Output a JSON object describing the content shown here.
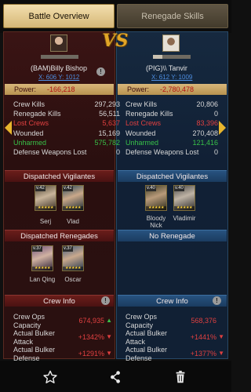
{
  "tabs": {
    "active": "Battle Overview",
    "inactive": "Renegade Skills"
  },
  "vs_label": "VS",
  "left": {
    "name": "(BAM)Billy Bishop",
    "coords": "X: 606 Y: 1012",
    "power_label": "Power:",
    "power": "-166,218",
    "stats": [
      {
        "label": "Crew Kills",
        "value": "297,293",
        "color": "default"
      },
      {
        "label": "Renegade Kills",
        "value": "56,511",
        "color": "default"
      },
      {
        "label": "Lost Crews",
        "value": "5,637",
        "color": "red"
      },
      {
        "label": "Wounded",
        "value": "15,169",
        "color": "default"
      },
      {
        "label": "Unharmed",
        "value": "575,782",
        "color": "green"
      },
      {
        "label": "Defense Weapons Lost",
        "value": "0",
        "color": "default"
      }
    ],
    "vigilantes_title": "Dispatched Vigilantes",
    "vigilantes": [
      {
        "level": "v.42",
        "name": "Serj"
      },
      {
        "level": "v.42",
        "name": "Vlad"
      }
    ],
    "renegades_title": "Dispatched Renegades",
    "renegades": [
      {
        "level": "v.37",
        "name": "Lan Qing"
      },
      {
        "level": "v.37",
        "name": "Oscar"
      }
    ],
    "crew_info_title": "Crew Info",
    "crew_info": [
      {
        "label": "Crew Ops Capacity",
        "value": "674,935",
        "indicator": "up"
      },
      {
        "label": "Actual Bulker Attack",
        "value": "+1342%",
        "indicator": "down"
      },
      {
        "label": "Actual Bulker Defense",
        "value": "+1291%",
        "indicator": "down"
      }
    ]
  },
  "right": {
    "name": "(PIG)\\\\ Tanvir",
    "coords": "X: 612 Y: 1009",
    "power_label": "Power:",
    "power": "-2,780,478",
    "stats": [
      {
        "label": "Crew Kills",
        "value": "20,806",
        "color": "default"
      },
      {
        "label": "Renegade Kills",
        "value": "0",
        "color": "default"
      },
      {
        "label": "Lost Crews",
        "value": "83,396",
        "color": "red"
      },
      {
        "label": "Wounded",
        "value": "270,408",
        "color": "default"
      },
      {
        "label": "Unharmed",
        "value": "121,416",
        "color": "green"
      },
      {
        "label": "Defense Weapons Lost",
        "value": "0",
        "color": "default"
      }
    ],
    "vigilantes_title": "Dispatched Vigilantes",
    "vigilantes": [
      {
        "level": "v.40",
        "name": "Bloody Nick"
      },
      {
        "level": "v.40",
        "name": "Vladimir"
      }
    ],
    "renegades_title": "No Renegade",
    "crew_info_title": "Crew Info",
    "crew_info": [
      {
        "label": "Crew Ops Capacity",
        "value": "568,376"
      },
      {
        "label": "Actual Bulker Attack",
        "value": "+1441%"
      },
      {
        "label": "Actual Bulker Defense",
        "value": "+1377%"
      }
    ]
  },
  "colors": {
    "red": "#e04040",
    "green": "#38c048",
    "gold": "#e7b52d",
    "link": "#4d8de0"
  },
  "footer_icons": [
    "star-icon",
    "share-icon",
    "trash-icon"
  ]
}
